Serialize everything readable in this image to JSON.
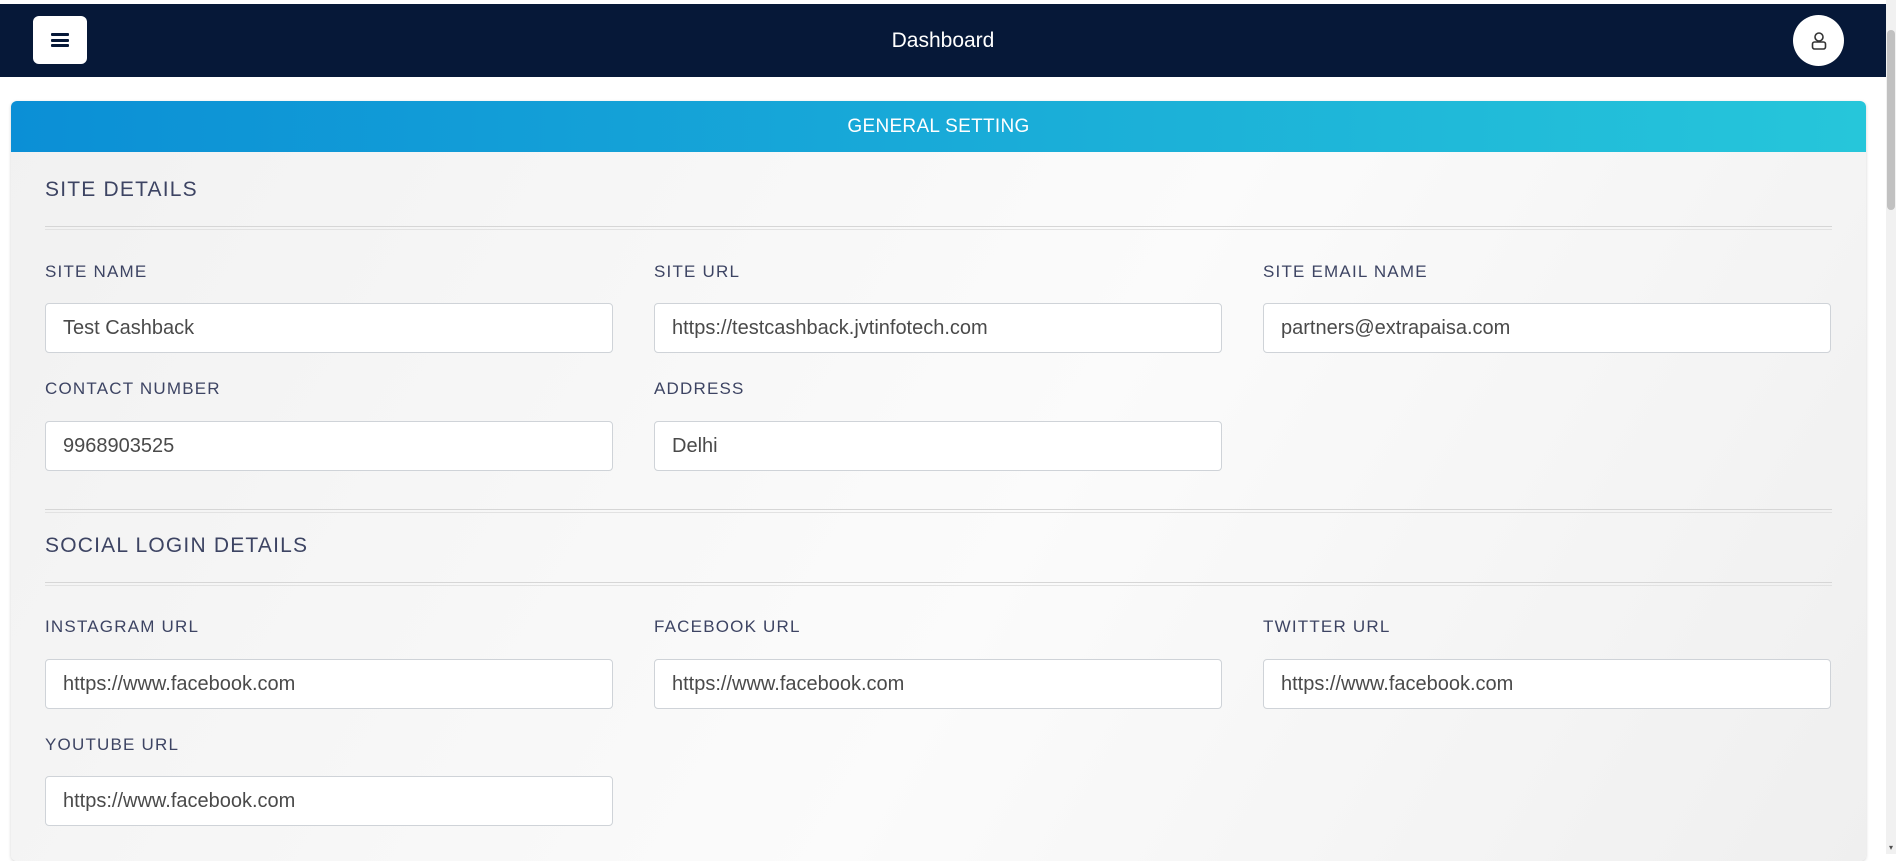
{
  "header": {
    "title": "Dashboard",
    "menu_icon": "hamburger-menu-icon",
    "user_icon": "user-icon"
  },
  "card": {
    "title": "GENERAL SETTING"
  },
  "site_details": {
    "title": "SITE DETAILS",
    "fields": {
      "site_name": {
        "label": "SITE NAME",
        "value": "Test Cashback"
      },
      "site_url": {
        "label": "SITE URL",
        "value": "https://testcashback.jvtinfotech.com"
      },
      "site_email": {
        "label": "SITE EMAIL NAME",
        "value": "partners@extrapaisa.com"
      },
      "contact_number": {
        "label": "CONTACT NUMBER",
        "value": "9968903525"
      },
      "address": {
        "label": "ADDRESS",
        "value": "Delhi"
      }
    }
  },
  "social_login": {
    "title": "SOCIAL LOGIN DETAILS",
    "fields": {
      "instagram": {
        "label": "INSTAGRAM URL",
        "value": "https://www.facebook.com"
      },
      "facebook": {
        "label": "FACEBOOK URL",
        "value": "https://www.facebook.com"
      },
      "twitter": {
        "label": "TWITTER URL",
        "value": "https://www.facebook.com"
      },
      "youtube": {
        "label": "YOUTUBE URL",
        "value": "https://www.facebook.com"
      }
    }
  },
  "colors": {
    "navbar": "#061838",
    "header_gradient_start": "#0b8fd6",
    "header_gradient_end": "#26c6da",
    "label_text": "#3d4463"
  }
}
